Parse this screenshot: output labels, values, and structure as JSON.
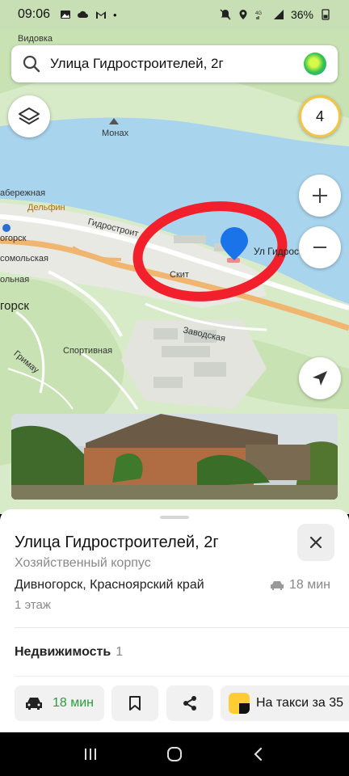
{
  "status_bar": {
    "time": "09:06",
    "battery": "36%"
  },
  "search": {
    "query": "Улица Гидростроителей, 2г"
  },
  "map": {
    "labels": {
      "vidovka": "Видовка",
      "monakh": "Монах",
      "naberezhnaya": "абережная",
      "delfin": "Дельфин",
      "gidrostroi": "Гидростроит",
      "nogorsk": "огорск",
      "komsomolskaya": "сомольская",
      "volnaya": "ольная",
      "gorsk": "горск",
      "skit": "Скит",
      "zavodskaya": "Заводская",
      "sportivnaya": "Спортивная",
      "grimau": "Гримау",
      "pin_label": "Ул Гидростроит"
    },
    "layers_badge": "4",
    "accent_pin": "#1a73e8",
    "annotation_color": "#f2202c"
  },
  "sheet": {
    "title": "Улица Гидростроителей, 2г",
    "subtitle": "Хозяйственный корпус",
    "address": "Дивногорск, Красноярский край",
    "drive_time": "18 мин",
    "floor": "1 этаж",
    "realty_label": "Недвижимость",
    "realty_count": "1"
  },
  "actions": {
    "route_time": "18 мин",
    "taxi": "На такси за 35"
  }
}
